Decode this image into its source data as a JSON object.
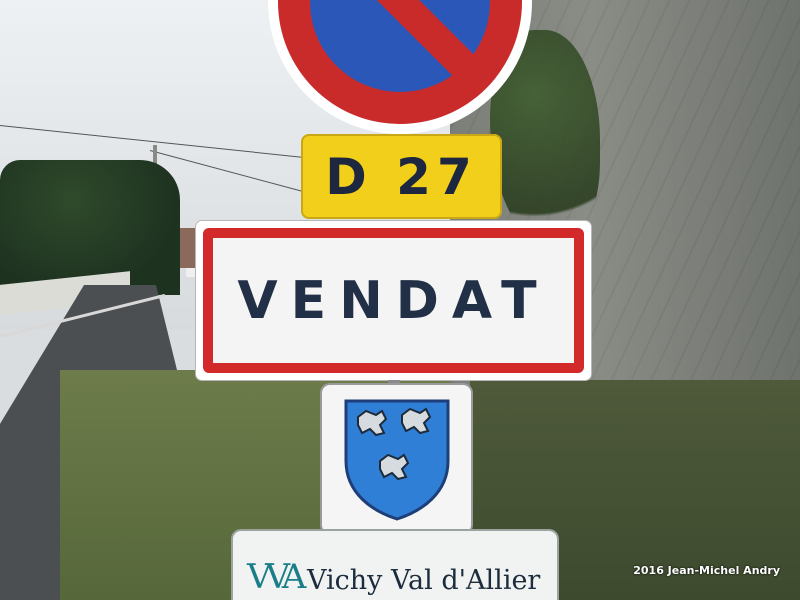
{
  "signs": {
    "route_number": "D 27",
    "town_name": "VENDAT",
    "bottom_sign_logo": "VVA",
    "bottom_sign_text": "Vichy Val d'Allier",
    "crest_icon": "lion-shield-icon"
  },
  "credit": "2016 Jean-Michel Andry",
  "colors": {
    "sign_red": "#d22a2a",
    "sign_blue": "#2b58b8",
    "route_yellow": "#f2cf1a",
    "text_navy": "#223047"
  }
}
